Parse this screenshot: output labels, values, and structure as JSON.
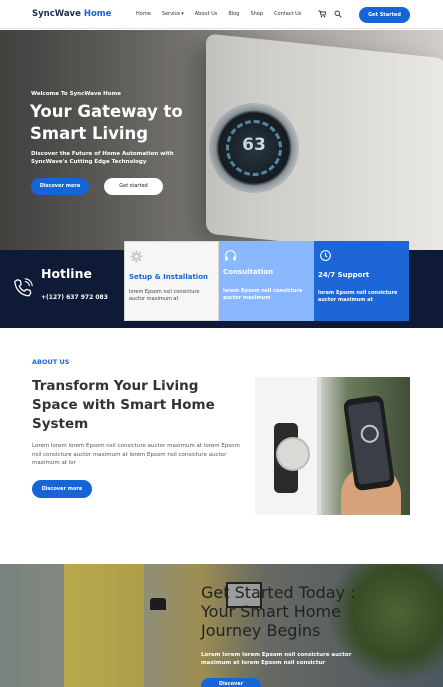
{
  "nav": {
    "logo_primary": "SyncWave",
    "logo_accent": "Home",
    "menu": [
      {
        "label": "Home",
        "has_dropdown": false
      },
      {
        "label": "Service",
        "has_dropdown": true
      },
      {
        "label": "About Us",
        "has_dropdown": false
      },
      {
        "label": "Blog",
        "has_dropdown": false
      },
      {
        "label": "Shop",
        "has_dropdown": false
      },
      {
        "label": "Contact Us",
        "has_dropdown": false
      }
    ],
    "cart_icon": "cart-icon",
    "search_icon": "search-icon",
    "cta_label": "Get Started"
  },
  "hero": {
    "eyebrow": "Welcome To SyncWave Home",
    "title": "Your Gateway to Smart Living",
    "subtitle": "Discover the Future of Home Automation with SyncWave's Cutting Edge Technology",
    "primary_button": "Discover more",
    "secondary_button": "Get started",
    "thermostat_reading": "63"
  },
  "hotline": {
    "icon": "phone-icon",
    "label": "Hotline",
    "number": "+(127) 637 972 083"
  },
  "services": [
    {
      "icon": "gear-icon",
      "title": "Setup & Installation",
      "text": "lorem Epsom  nsil consicture auctor maximum at"
    },
    {
      "icon": "headphones-icon",
      "title": "Consultation",
      "text": "lorem Epsom  nsil consicture auctor maximum"
    },
    {
      "icon": "clock-icon",
      "title": "24/7 Support",
      "text": "lorem Epsom  nsil consicture auctor maximum at"
    }
  ],
  "about": {
    "tag": "ABOUT US",
    "title": "Transform Your Living Space with Smart Home System",
    "text": "Lorem lorem lorem Epsom  nsil consicture auctor maximum at lorem Epsom  nsil consicture auctor maximum at lorem Epsom  nsil consicture auctor maximum at lor",
    "button": "Discover more"
  },
  "cta": {
    "title": "Get Started Today : Your Smart Home Journey  Begins",
    "text": "Lorem lorem lorem Epsom  nsil consicture auctor maximum at lorem Epsom  nsil consictur",
    "button": "Discover"
  },
  "colors": {
    "brand_blue": "#1565d8",
    "navy": "#0e1a36",
    "light_blue": "#8ab8ff"
  }
}
